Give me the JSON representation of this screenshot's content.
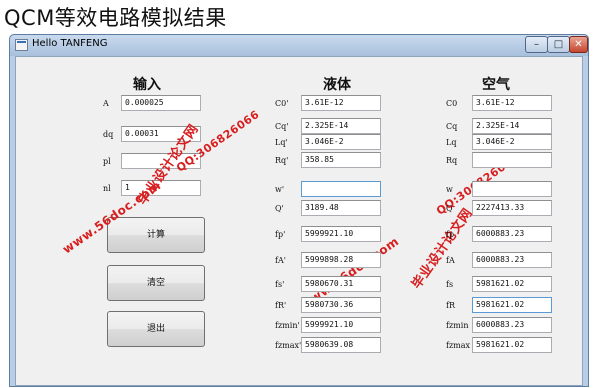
{
  "heading": "QCM等效电路模拟结果",
  "window": {
    "title": "Hello TANFENG",
    "controls": {
      "minimize": "–",
      "maximize": "□",
      "close": "✕"
    }
  },
  "columns": {
    "input": "输入",
    "liquid": "液体",
    "air": "空气"
  },
  "input_fields": [
    {
      "label": "A",
      "value": "0.000025"
    },
    {
      "label": "dq",
      "value": "0.00031"
    },
    {
      "label": "pl",
      "value": ""
    },
    {
      "label": "nl",
      "value": "1"
    }
  ],
  "buttons": {
    "calculate": "计算",
    "clear": "清空",
    "exit": "退出"
  },
  "liquid_fields": [
    {
      "label": "C0'",
      "value": "3.61E-12"
    },
    {
      "label": "Cq'",
      "value": "2.325E-14"
    },
    {
      "label": "Lq'",
      "value": "3.046E-2"
    },
    {
      "label": "Rq'",
      "value": "358.85"
    },
    {
      "label": "w'",
      "value": ""
    },
    {
      "label": "Q'",
      "value": "3189.48"
    },
    {
      "label": "fp'",
      "value": "5999921.10"
    },
    {
      "label": "fA'",
      "value": "5999898.28"
    },
    {
      "label": "fs'",
      "value": "5980670.31"
    },
    {
      "label": "fR'",
      "value": "5980730.36"
    },
    {
      "label": "fzmin'",
      "value": "5999921.10"
    },
    {
      "label": "fzmax'",
      "value": "5980639.08"
    }
  ],
  "air_fields": [
    {
      "label": "C0",
      "value": "3.61E-12"
    },
    {
      "label": "Cq",
      "value": "2.325E-14"
    },
    {
      "label": "Lq",
      "value": "3.046E-2"
    },
    {
      "label": "Rq",
      "value": ""
    },
    {
      "label": "w",
      "value": ""
    },
    {
      "label": "Q",
      "value": "2227413.33"
    },
    {
      "label": "fp",
      "value": "6000883.23"
    },
    {
      "label": "fA",
      "value": "6000883.23"
    },
    {
      "label": "fs",
      "value": "5981621.02"
    },
    {
      "label": "fR",
      "value": "5981621.02"
    },
    {
      "label": "fzmin",
      "value": "6000883.23"
    },
    {
      "label": "fzmax",
      "value": "5981621.02"
    }
  ],
  "watermarks": {
    "site_left": "www.56doc.com",
    "qq_left": "QQ:306826066",
    "name_left": "毕业设计论文网",
    "site_right": "www.56doc.com",
    "qq_right": "QQ:306826066",
    "name_right": "毕业设计论文网"
  }
}
